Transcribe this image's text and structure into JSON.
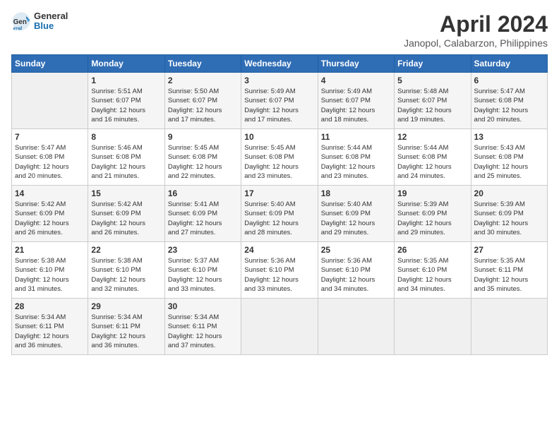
{
  "header": {
    "logo_general": "General",
    "logo_blue": "Blue",
    "month_title": "April 2024",
    "location": "Janopol, Calabarzon, Philippines"
  },
  "calendar": {
    "days_of_week": [
      "Sunday",
      "Monday",
      "Tuesday",
      "Wednesday",
      "Thursday",
      "Friday",
      "Saturday"
    ],
    "weeks": [
      [
        {
          "day": "",
          "info": ""
        },
        {
          "day": "1",
          "info": "Sunrise: 5:51 AM\nSunset: 6:07 PM\nDaylight: 12 hours\nand 16 minutes."
        },
        {
          "day": "2",
          "info": "Sunrise: 5:50 AM\nSunset: 6:07 PM\nDaylight: 12 hours\nand 17 minutes."
        },
        {
          "day": "3",
          "info": "Sunrise: 5:49 AM\nSunset: 6:07 PM\nDaylight: 12 hours\nand 17 minutes."
        },
        {
          "day": "4",
          "info": "Sunrise: 5:49 AM\nSunset: 6:07 PM\nDaylight: 12 hours\nand 18 minutes."
        },
        {
          "day": "5",
          "info": "Sunrise: 5:48 AM\nSunset: 6:07 PM\nDaylight: 12 hours\nand 19 minutes."
        },
        {
          "day": "6",
          "info": "Sunrise: 5:47 AM\nSunset: 6:08 PM\nDaylight: 12 hours\nand 20 minutes."
        }
      ],
      [
        {
          "day": "7",
          "info": "Sunrise: 5:47 AM\nSunset: 6:08 PM\nDaylight: 12 hours\nand 20 minutes."
        },
        {
          "day": "8",
          "info": "Sunrise: 5:46 AM\nSunset: 6:08 PM\nDaylight: 12 hours\nand 21 minutes."
        },
        {
          "day": "9",
          "info": "Sunrise: 5:45 AM\nSunset: 6:08 PM\nDaylight: 12 hours\nand 22 minutes."
        },
        {
          "day": "10",
          "info": "Sunrise: 5:45 AM\nSunset: 6:08 PM\nDaylight: 12 hours\nand 23 minutes."
        },
        {
          "day": "11",
          "info": "Sunrise: 5:44 AM\nSunset: 6:08 PM\nDaylight: 12 hours\nand 23 minutes."
        },
        {
          "day": "12",
          "info": "Sunrise: 5:44 AM\nSunset: 6:08 PM\nDaylight: 12 hours\nand 24 minutes."
        },
        {
          "day": "13",
          "info": "Sunrise: 5:43 AM\nSunset: 6:08 PM\nDaylight: 12 hours\nand 25 minutes."
        }
      ],
      [
        {
          "day": "14",
          "info": "Sunrise: 5:42 AM\nSunset: 6:09 PM\nDaylight: 12 hours\nand 26 minutes."
        },
        {
          "day": "15",
          "info": "Sunrise: 5:42 AM\nSunset: 6:09 PM\nDaylight: 12 hours\nand 26 minutes."
        },
        {
          "day": "16",
          "info": "Sunrise: 5:41 AM\nSunset: 6:09 PM\nDaylight: 12 hours\nand 27 minutes."
        },
        {
          "day": "17",
          "info": "Sunrise: 5:40 AM\nSunset: 6:09 PM\nDaylight: 12 hours\nand 28 minutes."
        },
        {
          "day": "18",
          "info": "Sunrise: 5:40 AM\nSunset: 6:09 PM\nDaylight: 12 hours\nand 29 minutes."
        },
        {
          "day": "19",
          "info": "Sunrise: 5:39 AM\nSunset: 6:09 PM\nDaylight: 12 hours\nand 29 minutes."
        },
        {
          "day": "20",
          "info": "Sunrise: 5:39 AM\nSunset: 6:09 PM\nDaylight: 12 hours\nand 30 minutes."
        }
      ],
      [
        {
          "day": "21",
          "info": "Sunrise: 5:38 AM\nSunset: 6:10 PM\nDaylight: 12 hours\nand 31 minutes."
        },
        {
          "day": "22",
          "info": "Sunrise: 5:38 AM\nSunset: 6:10 PM\nDaylight: 12 hours\nand 32 minutes."
        },
        {
          "day": "23",
          "info": "Sunrise: 5:37 AM\nSunset: 6:10 PM\nDaylight: 12 hours\nand 33 minutes."
        },
        {
          "day": "24",
          "info": "Sunrise: 5:36 AM\nSunset: 6:10 PM\nDaylight: 12 hours\nand 33 minutes."
        },
        {
          "day": "25",
          "info": "Sunrise: 5:36 AM\nSunset: 6:10 PM\nDaylight: 12 hours\nand 34 minutes."
        },
        {
          "day": "26",
          "info": "Sunrise: 5:35 AM\nSunset: 6:10 PM\nDaylight: 12 hours\nand 34 minutes."
        },
        {
          "day": "27",
          "info": "Sunrise: 5:35 AM\nSunset: 6:11 PM\nDaylight: 12 hours\nand 35 minutes."
        }
      ],
      [
        {
          "day": "28",
          "info": "Sunrise: 5:34 AM\nSunset: 6:11 PM\nDaylight: 12 hours\nand 36 minutes."
        },
        {
          "day": "29",
          "info": "Sunrise: 5:34 AM\nSunset: 6:11 PM\nDaylight: 12 hours\nand 36 minutes."
        },
        {
          "day": "30",
          "info": "Sunrise: 5:34 AM\nSunset: 6:11 PM\nDaylight: 12 hours\nand 37 minutes."
        },
        {
          "day": "",
          "info": ""
        },
        {
          "day": "",
          "info": ""
        },
        {
          "day": "",
          "info": ""
        },
        {
          "day": "",
          "info": ""
        }
      ]
    ]
  }
}
